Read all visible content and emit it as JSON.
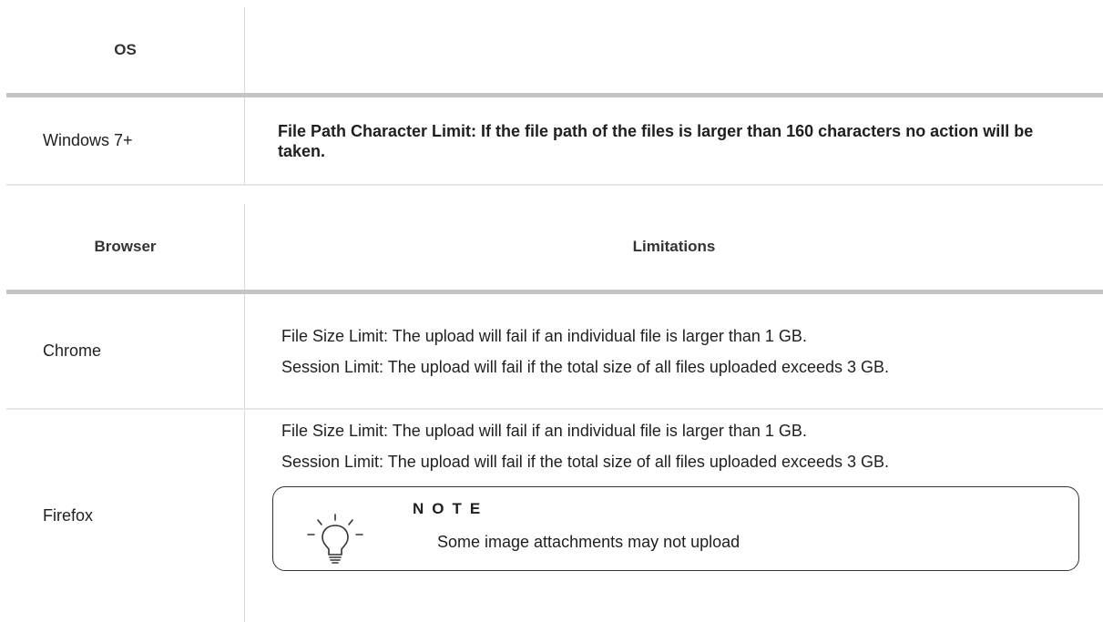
{
  "os_table": {
    "header": {
      "col1": "OS",
      "col2": ""
    },
    "rows": [
      {
        "os": "Windows 7+",
        "limitation": "File Path Character Limit: If the file path of the files is larger than 160 characters no action will be taken."
      }
    ]
  },
  "browser_table": {
    "header": {
      "col1": "Browser",
      "col2": "Limitations"
    },
    "rows": [
      {
        "browser": "Chrome",
        "lines": [
          "File Size Limit: The upload will fail if an individual file is larger than 1 GB.",
          "Session Limit: The upload will fail if the total size of all files uploaded exceeds 3 GB."
        ]
      },
      {
        "browser": "Firefox",
        "lines": [
          "File Size Limit: The upload will fail if an individual file is larger than 1 GB.",
          "Session Limit: The upload will fail if the total size of all files uploaded exceeds 3 GB."
        ],
        "note": {
          "title": "NOTE",
          "text": "Some image attachments may not upload",
          "icon": "lightbulb-icon"
        }
      }
    ]
  }
}
